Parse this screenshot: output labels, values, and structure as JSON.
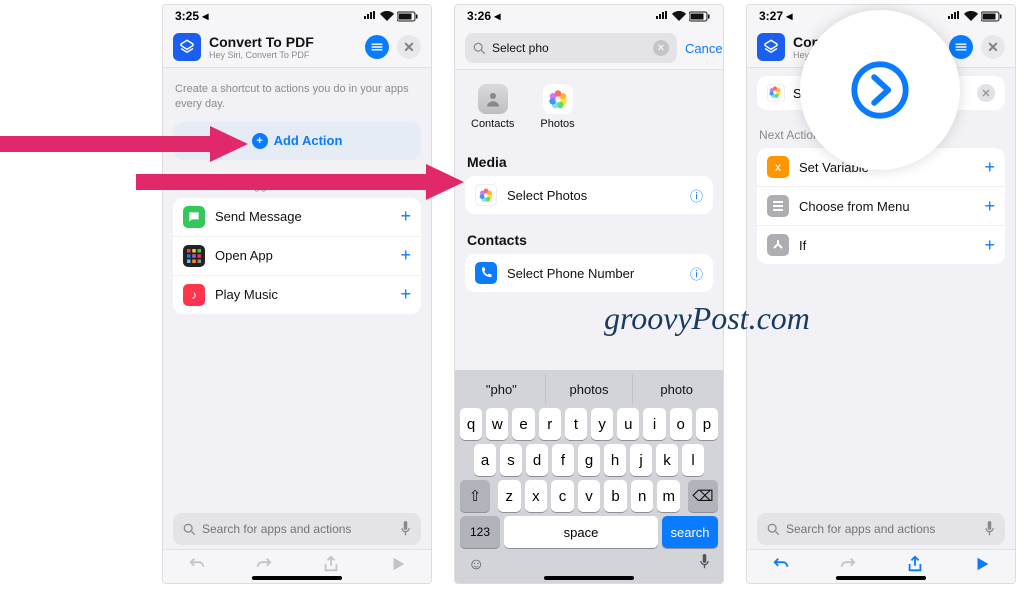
{
  "watermark": "groovyPost.com",
  "screens": {
    "s1": {
      "time": "3:25",
      "title": "Convert To PDF",
      "subtitle": "Hey Siri, Convert To PDF",
      "hint": "Create a shortcut to actions you do in your apps every day.",
      "add_action": "Add Action",
      "suggestions_label": "Next Action Suggestions",
      "suggestions": [
        {
          "label": "Send Message",
          "icon": "message",
          "color": "#34c759"
        },
        {
          "label": "Open App",
          "icon": "grid",
          "color": "#ff3b30"
        },
        {
          "label": "Play Music",
          "icon": "music",
          "color": "#fc3c44"
        }
      ],
      "search_placeholder": "Search for apps and actions"
    },
    "s2": {
      "time": "3:26",
      "search_value": "Select pho",
      "cancel": "Cancel",
      "categories": [
        {
          "label": "Contacts",
          "icon": "contacts"
        },
        {
          "label": "Photos",
          "icon": "photos"
        }
      ],
      "media_label": "Media",
      "media_row": "Select Photos",
      "contacts_label": "Contacts",
      "contacts_row": "Select Phone Number",
      "predictions": [
        "\"pho\"",
        "photos",
        "photo"
      ],
      "keys_r1": [
        "q",
        "w",
        "e",
        "r",
        "t",
        "y",
        "u",
        "i",
        "o",
        "p"
      ],
      "keys_r2": [
        "a",
        "s",
        "d",
        "f",
        "g",
        "h",
        "j",
        "k",
        "l"
      ],
      "keys_r3": [
        "z",
        "x",
        "c",
        "v",
        "b",
        "n",
        "m"
      ],
      "numbers": "123",
      "space": "space",
      "search": "search"
    },
    "s3": {
      "time": "3:27",
      "title_partial": "Con",
      "sub_partial": "Hey S",
      "chip_label": "Se",
      "suggestions_label_partial": "Next Action S",
      "suggestions": [
        {
          "label": "Set Variable",
          "icon": "var",
          "color": "#ff9500"
        },
        {
          "label": "Choose from Menu",
          "icon": "menu",
          "color": "#8e8e93"
        },
        {
          "label": "If",
          "icon": "if",
          "color": "#8e8e93"
        }
      ],
      "search_placeholder": "Search for apps and actions"
    }
  }
}
